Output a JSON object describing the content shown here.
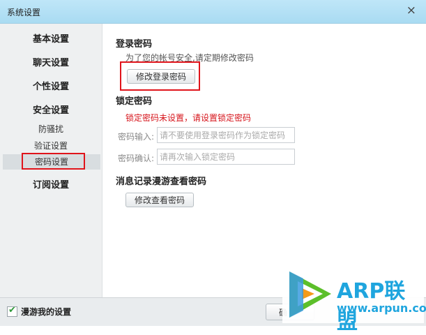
{
  "window": {
    "title": "系统设置",
    "close": "×"
  },
  "sidebar": {
    "items": [
      {
        "label": "基本设置"
      },
      {
        "label": "聊天设置"
      },
      {
        "label": "个性设置"
      },
      {
        "label": "安全设置"
      },
      {
        "label": "防骚扰"
      },
      {
        "label": "验证设置"
      },
      {
        "label": "密码设置",
        "active": true
      },
      {
        "label": "订阅设置"
      }
    ]
  },
  "login_password": {
    "title": "登录密码",
    "hint": "为了您的帐号安全,请定期修改密码",
    "button": "修改登录密码"
  },
  "lock_password": {
    "title": "锁定密码",
    "warning": "锁定密码未设置，请设置锁定密码",
    "input_label": "密码输入:",
    "input_placeholder": "请不要使用登录密码作为锁定密码",
    "confirm_label": "密码确认:",
    "confirm_placeholder": "请再次输入锁定密码"
  },
  "history_password": {
    "title": "消息记录漫游查看密码",
    "button": "修改查看密码"
  },
  "footer": {
    "roam_checkbox": "漫游我的设置",
    "roam_checked": true,
    "ok_button_partial": "确"
  },
  "watermark": {
    "brand": "ARP联盟",
    "url": "www.arpun.com",
    "colors": {
      "brand": "#1fa5de",
      "play_green": "#5cbf2a",
      "play_orange": "#f39a1a"
    }
  },
  "colors": {
    "highlight": "#e0141b",
    "warning": "#d6141b"
  }
}
